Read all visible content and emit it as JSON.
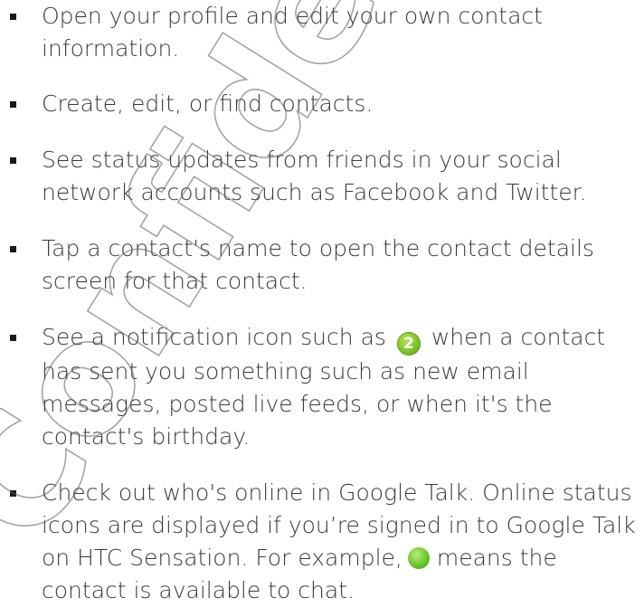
{
  "items": [
    {
      "text": "Open your profile and edit your own contact information."
    },
    {
      "text": "Create, edit, or find contacts."
    },
    {
      "text": "See status updates from friends in your social network accounts such as Facebook and Twitter."
    },
    {
      "text": "Tap a contact's name to open the contact details screen for that contact."
    },
    {
      "before": "See a notification icon such as",
      "badge": "2",
      "after": "when a contact has sent you something such as new email messages, posted live feeds, or when it's the contact's birthday."
    },
    {
      "before": "Check out who's online in Google Talk. Online status icons are displayed if you’re signed in to Google Talk on HTC Sensation. For example,",
      "after": "means the contact is available to chat."
    }
  ],
  "watermark_text": "Confidential certification only",
  "colors": {
    "text": "#3a3a3a",
    "badge_green": "#7cc22a",
    "online_green": "#6cc62a"
  },
  "icons": {
    "notification": "notification-badge-icon",
    "online": "online-status-icon"
  }
}
